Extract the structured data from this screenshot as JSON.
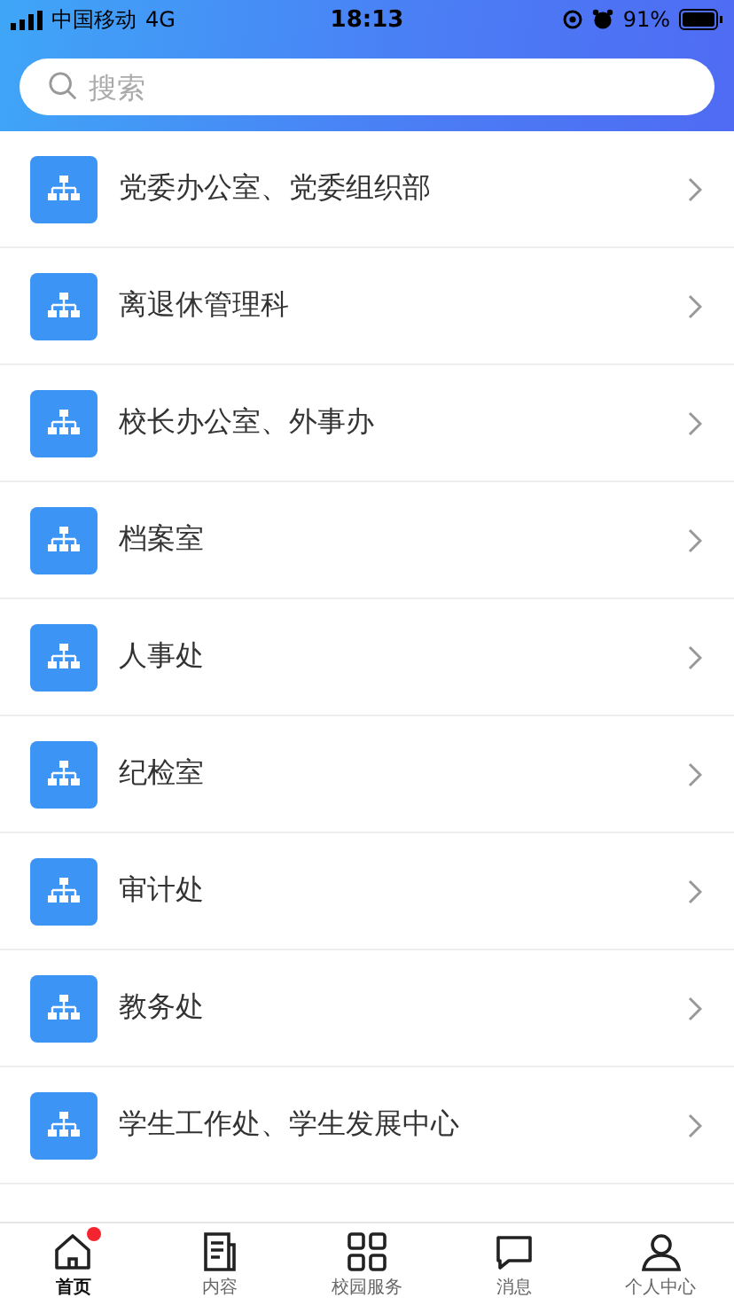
{
  "status_bar": {
    "carrier": "中国移动",
    "network": "4G",
    "time": "18:13",
    "battery": "91%"
  },
  "search": {
    "placeholder": "搜索"
  },
  "departments": [
    {
      "name": "党委办公室、党委组织部"
    },
    {
      "name": "离退休管理科"
    },
    {
      "name": "校长办公室、外事办"
    },
    {
      "name": "档案室"
    },
    {
      "name": "人事处"
    },
    {
      "name": "纪检室"
    },
    {
      "name": "审计处"
    },
    {
      "name": "教务处"
    },
    {
      "name": "学生工作处、学生发展中心"
    }
  ],
  "tab_bar": [
    {
      "label": "首页",
      "kind": "home",
      "selected": true,
      "badge": true
    },
    {
      "label": "内容",
      "kind": "doc",
      "selected": false,
      "badge": false
    },
    {
      "label": "校园服务",
      "kind": "grid",
      "selected": false,
      "badge": false
    },
    {
      "label": "消息",
      "kind": "chat",
      "selected": false,
      "badge": false
    },
    {
      "label": "个人中心",
      "kind": "person",
      "selected": false,
      "badge": false
    }
  ]
}
